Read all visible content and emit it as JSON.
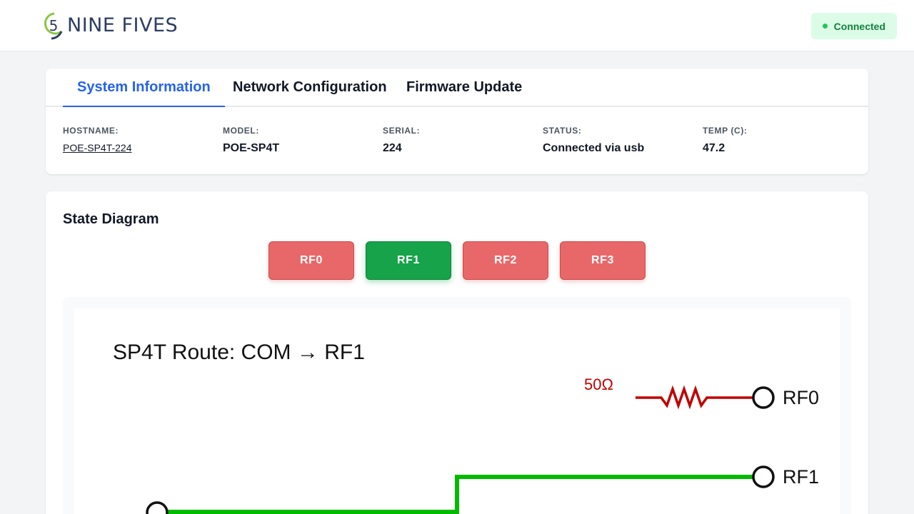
{
  "header": {
    "logo_text": "NINE FIVES",
    "logo_glyph": "5",
    "connection_status": "Connected"
  },
  "tabs": [
    {
      "label": "System Information",
      "active": true
    },
    {
      "label": "Network Configuration",
      "active": false
    },
    {
      "label": "Firmware Update",
      "active": false
    }
  ],
  "system_info": {
    "hostname_label": "HOSTNAME:",
    "hostname": "POE-SP4T-224",
    "model_label": "MODEL:",
    "model": "POE-SP4T",
    "serial_label": "SERIAL:",
    "serial": "224",
    "status_label": "STATUS:",
    "status": "Connected via usb",
    "temp_label": "TEMP (C):",
    "temp": "47.2"
  },
  "state_diagram": {
    "title": "State Diagram",
    "buttons": [
      {
        "label": "RF0",
        "active": false
      },
      {
        "label": "RF1",
        "active": true
      },
      {
        "label": "RF2",
        "active": false
      },
      {
        "label": "RF3",
        "active": false
      }
    ],
    "route_title": "SP4T Route: COM → RF1",
    "termination_label": "50Ω",
    "port_labels": [
      "RF0",
      "RF1"
    ],
    "colors": {
      "active_path": "#00bb00",
      "termination": "#c00000",
      "button_active": "#16a34a",
      "button_inactive": "#e8686a"
    }
  }
}
